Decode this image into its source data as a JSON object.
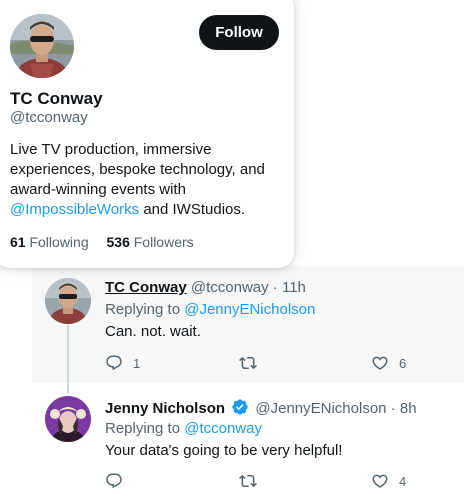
{
  "colors": {
    "accent": "#1d9bf0",
    "text_primary": "#0f1419",
    "text_secondary": "#536471",
    "like_hover": "#f91880"
  },
  "hover_card": {
    "follow_label": "Follow",
    "name": "TC Conway",
    "handle": "@tcconway",
    "bio_before": "Live TV production, immersive experiences, bespoke technology, and award-winning events with ",
    "bio_link": "@ImpossibleWorks",
    "bio_after": " and IWStudios.",
    "following_count": "61",
    "following_label": "Following",
    "followers_count": "536",
    "followers_label": "Followers"
  },
  "tweets": [
    {
      "name": "TC Conway",
      "handle": "@tcconway",
      "separator": " · ",
      "time": "11h",
      "reply_prefix": "Replying to ",
      "reply_to": "@JennyENicholson",
      "text": "Can. not. wait.",
      "reply_count": "1",
      "retweet_count": "",
      "like_count": "6",
      "icons": [
        "reply-icon",
        "retweet-icon",
        "like-icon"
      ]
    },
    {
      "name": "Jenny Nicholson",
      "handle": "@JennyENicholson",
      "separator": " · ",
      "time": "8h",
      "verified": true,
      "reply_prefix": "Replying to ",
      "reply_to": "@tcconway",
      "text": "Your data's going to be very helpful!",
      "reply_count": "",
      "retweet_count": "",
      "like_count": "4",
      "icons": [
        "reply-icon",
        "retweet-icon",
        "like-icon",
        "verified-badge-icon"
      ]
    }
  ]
}
